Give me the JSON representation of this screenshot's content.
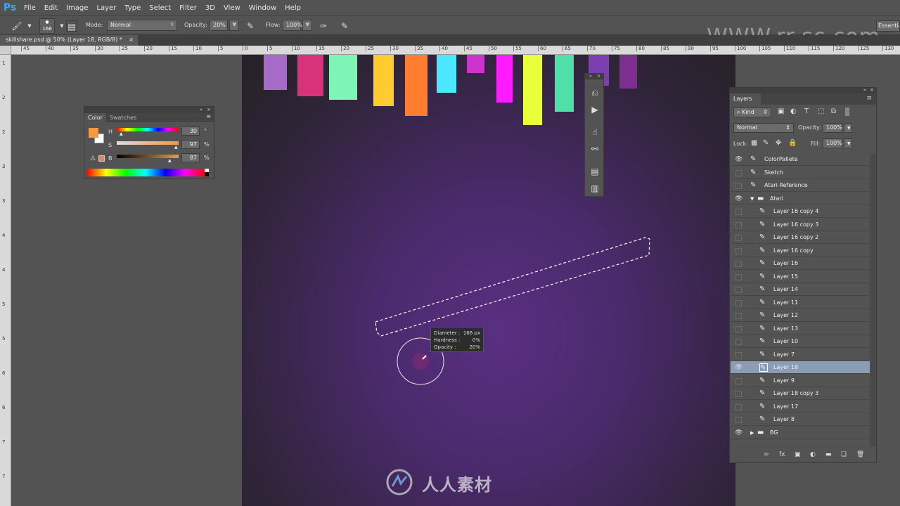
{
  "app": {
    "logo": "Ps"
  },
  "menu": [
    "File",
    "Edit",
    "Image",
    "Layer",
    "Type",
    "Select",
    "Filter",
    "3D",
    "View",
    "Window",
    "Help"
  ],
  "options": {
    "brush_size": "166",
    "mode_label": "Mode:",
    "mode_value": "Normal",
    "opacity_label": "Opacity:",
    "opacity_value": "20%",
    "flow_label": "Flow:",
    "flow_value": "100%",
    "workspace": "Essentials"
  },
  "watermark": {
    "url": "WWW.rr-sc.com",
    "cn": "人人素材"
  },
  "document_tab": {
    "title": "skillshare.psd @ 50% (Layer 18, RGB/8) *",
    "close": "×"
  },
  "ruler": {
    "h_ticks": [
      "45",
      "40",
      "35",
      "30",
      "25",
      "20",
      "15",
      "10",
      "5",
      "0",
      "5",
      "10",
      "15",
      "20",
      "25",
      "30",
      "35",
      "40",
      "45",
      "50",
      "55",
      "60",
      "65",
      "70",
      "75",
      "80",
      "85",
      "90",
      "95",
      "100",
      "105",
      "110",
      "115",
      "120",
      "125",
      "130",
      "135"
    ],
    "v_ticks": [
      "1",
      "2",
      "2",
      "3",
      "3",
      "4",
      "4",
      "5",
      "5",
      "6",
      "6",
      "7",
      "7"
    ]
  },
  "color_panel": {
    "tabs": [
      "Color",
      "Swatches"
    ],
    "h_label": "H",
    "h_value": "30",
    "h_unit": "°",
    "s_label": "S",
    "s_value": "97",
    "s_unit": "%",
    "b_label": "B",
    "b_value": "87",
    "b_unit": "%",
    "foreground_color": "#f39a3e"
  },
  "brush_hud": {
    "diameter_label": "Diameter :",
    "diameter_value": "166 px",
    "hardness_label": "Hardness :",
    "hardness_value": "0%",
    "opacity_label": "Opacity :",
    "opacity_value": "20%"
  },
  "color_bars": [
    "#a66bc9",
    "#d8327a",
    "#7ff5b5",
    "#ffcb2e",
    "#ff7d2e",
    "#4de6ff",
    "#cc33cc",
    "#ff1aff",
    "#e8ff3a",
    "#4ee0a8",
    "#7b3fb0",
    "#7e2e8e"
  ],
  "layers_panel": {
    "title": "Layers",
    "kind": "Kind",
    "blend_mode": "Normal",
    "opacity_label": "Opacity:",
    "opacity_value": "100%",
    "lock_label": "Lock:",
    "fill_label": "Fill:",
    "fill_value": "100%",
    "layers": [
      {
        "name": "ColorPallete",
        "visible": true,
        "indent": 0,
        "type": "brush"
      },
      {
        "name": "Sketch",
        "visible": false,
        "indent": 0,
        "type": "brush"
      },
      {
        "name": "Atari Reference",
        "visible": false,
        "indent": 0,
        "type": "brush"
      },
      {
        "name": "Atari",
        "visible": true,
        "indent": 0,
        "type": "group-open"
      },
      {
        "name": "Layer 16 copy 4",
        "visible": false,
        "indent": 1,
        "type": "brush"
      },
      {
        "name": "Layer 16 copy 3",
        "visible": false,
        "indent": 1,
        "type": "brush"
      },
      {
        "name": "Layer 16 copy 2",
        "visible": false,
        "indent": 1,
        "type": "brush"
      },
      {
        "name": "Layer 16 copy",
        "visible": false,
        "indent": 1,
        "type": "brush"
      },
      {
        "name": "Layer 16",
        "visible": false,
        "indent": 1,
        "type": "brush"
      },
      {
        "name": "Layer 15",
        "visible": false,
        "indent": 1,
        "type": "brush"
      },
      {
        "name": "Layer 14",
        "visible": false,
        "indent": 1,
        "type": "brush"
      },
      {
        "name": "Layer 11",
        "visible": false,
        "indent": 1,
        "type": "brush"
      },
      {
        "name": "Layer 12",
        "visible": false,
        "indent": 1,
        "type": "brush"
      },
      {
        "name": "Layer 13",
        "visible": false,
        "indent": 1,
        "type": "brush"
      },
      {
        "name": "Layer 10",
        "visible": false,
        "indent": 1,
        "type": "brush"
      },
      {
        "name": "Layer 7",
        "visible": false,
        "indent": 1,
        "type": "brush"
      },
      {
        "name": "Layer 18",
        "visible": true,
        "indent": 1,
        "type": "brush",
        "selected": true
      },
      {
        "name": "Layer 9",
        "visible": false,
        "indent": 1,
        "type": "brush"
      },
      {
        "name": "Layer 18 copy 3",
        "visible": false,
        "indent": 1,
        "type": "brush"
      },
      {
        "name": "Layer 17",
        "visible": false,
        "indent": 1,
        "type": "brush"
      },
      {
        "name": "Layer 8",
        "visible": false,
        "indent": 1,
        "type": "brush"
      },
      {
        "name": "BG",
        "visible": true,
        "indent": 0,
        "type": "group-closed"
      }
    ],
    "footer_icons": [
      "∞",
      "fx",
      "▣",
      "◐",
      "▬",
      "❏",
      "🗑"
    ]
  }
}
